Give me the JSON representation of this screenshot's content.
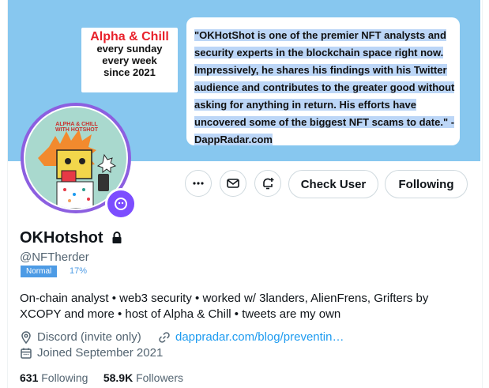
{
  "banner": {
    "promo_title": "Alpha & Chill",
    "promo_lines": [
      "every sunday",
      "every week",
      "since 2021"
    ],
    "quote_text": "\"OKHotShot is one of the premier NFT analysts and security experts in the blockchain space right now. Impressively, he shares his findings with his Twitter audience and contributes to the greater good without asking for anything in return. His efforts have uncovered some of the biggest NFT scams to date.\" - DappRadar.com",
    "avatar_caption": "ALPHA & CHILL\nWITH HOTSHOT"
  },
  "actions": {
    "check_user_label": "Check User",
    "following_label": "Following"
  },
  "profile": {
    "name": "OKHotshot",
    "handle": "@NFTherder",
    "tag": "Normal",
    "percent": "17%",
    "bio": "On-chain analyst • web3 security • worked w/ 3landers, AlienFrens, Grifters by XCOPY and more • host of Alpha & Chill • tweets are my own",
    "location": "Discord (invite only)",
    "link": "dappradar.com/blog/preventin…",
    "joined": "Joined September 2021"
  },
  "stats": {
    "following_count": "631",
    "following_label": "Following",
    "followers_count": "58.9K",
    "followers_label": "Followers"
  },
  "colors": {
    "banner": "#87c7ef",
    "link": "#1d9bf0",
    "tag": "#4d9be5",
    "badge": "#7c4dff"
  }
}
